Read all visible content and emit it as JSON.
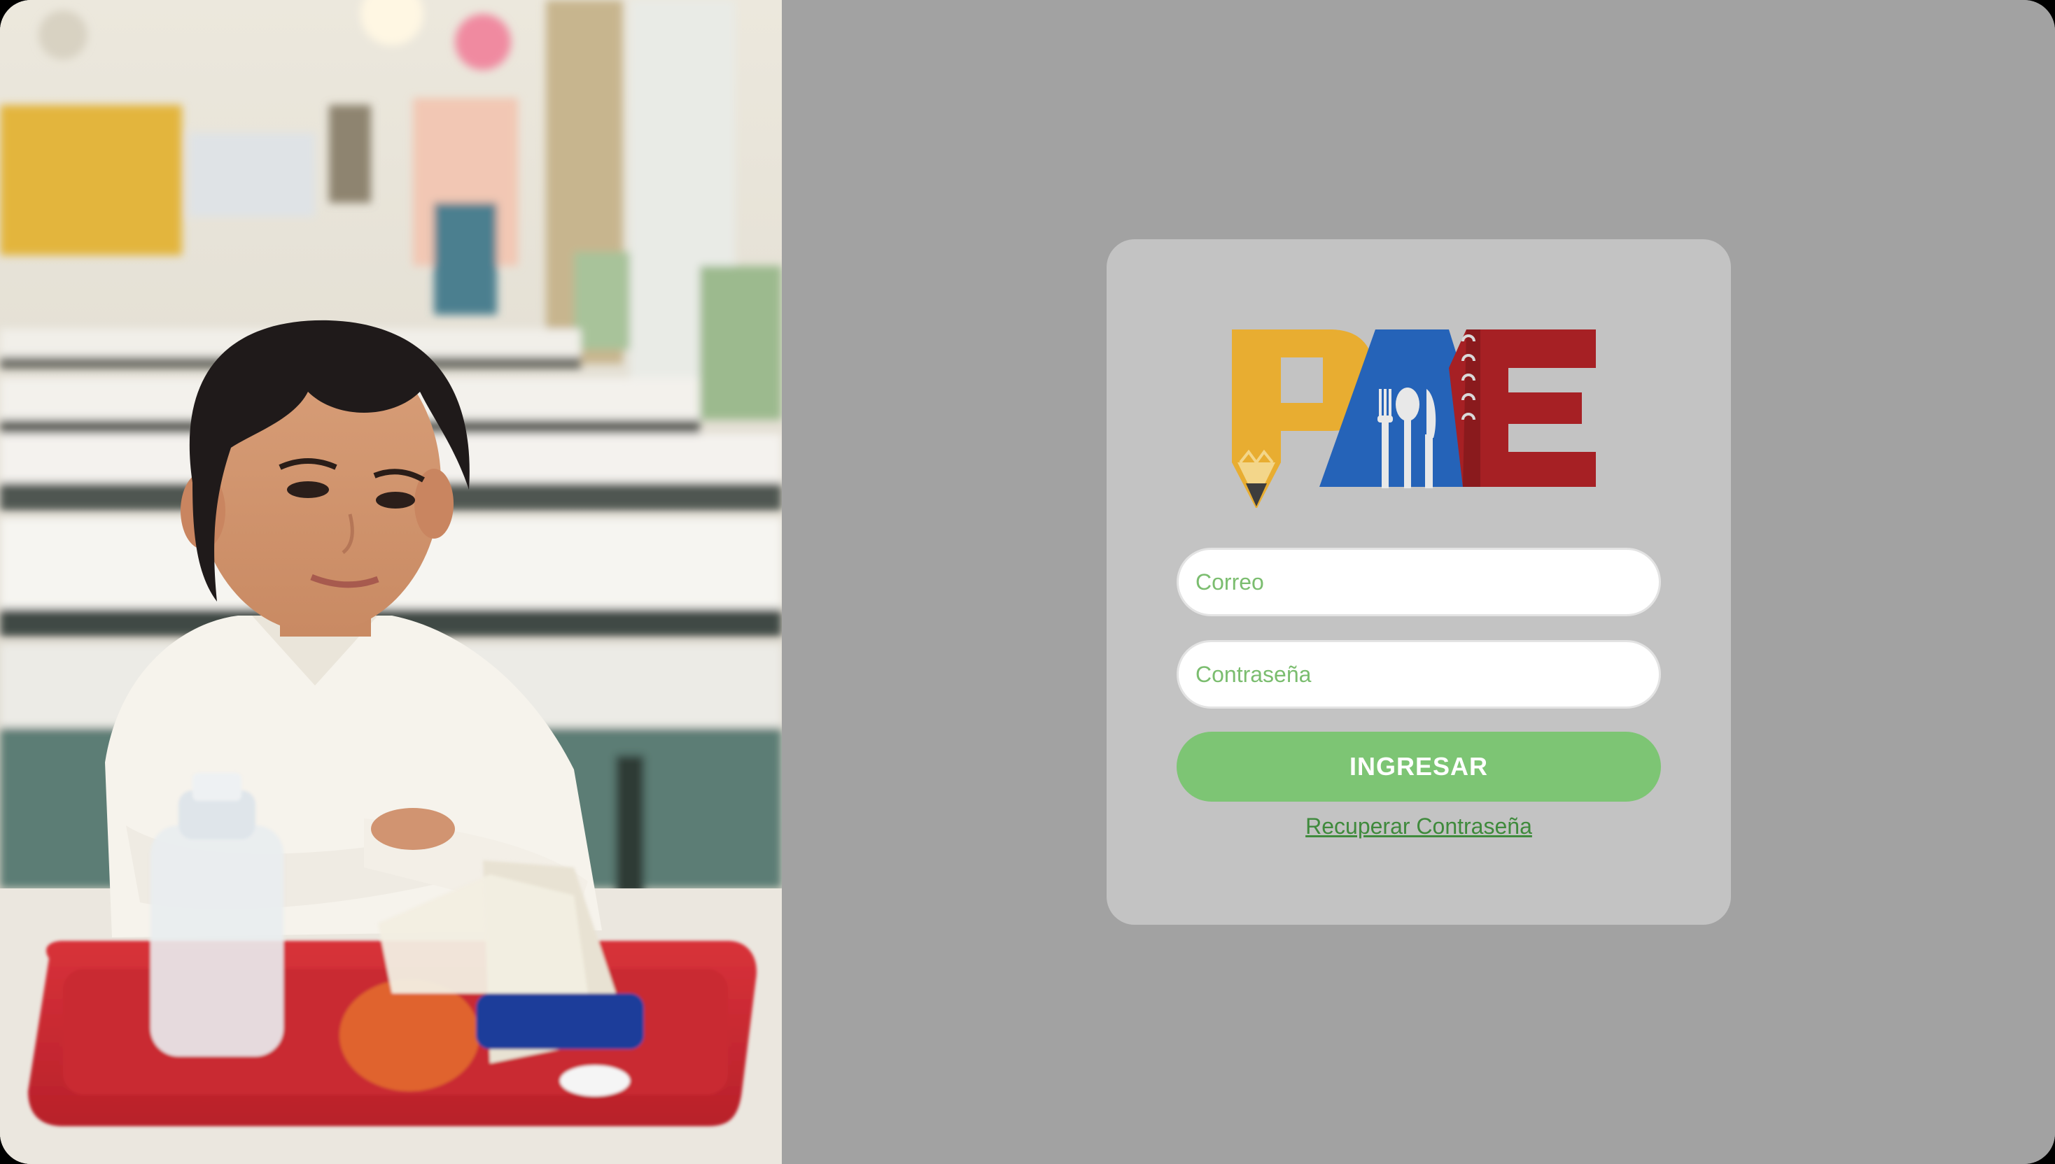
{
  "logo": {
    "text": "PAE",
    "colors": {
      "p": "#e8ad31",
      "a": "#2563b8",
      "e": "#a62024"
    }
  },
  "login": {
    "email_placeholder": "Correo",
    "password_placeholder": "Contraseña",
    "submit_label": "INGRESAR",
    "recover_label": "Recuperar Contraseña"
  },
  "theme": {
    "page_bg": "#a2a2a2",
    "card_bg": "#c3c3c3",
    "accent_green": "#7dc574",
    "link_green": "#3f8a3c",
    "placeholder_green": "#7bbd6f"
  }
}
